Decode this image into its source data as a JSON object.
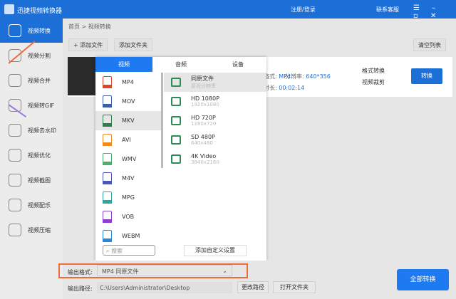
{
  "titlebar": {
    "title": "迅捷视频转换器",
    "login": "注册/登录",
    "support": "联系客服",
    "window_controls": "☰ – ▫ ✕"
  },
  "sidebar": {
    "items": [
      {
        "label": "视频转换"
      },
      {
        "label": "视频分割"
      },
      {
        "label": "视频合并"
      },
      {
        "label": "视频转GIF"
      },
      {
        "label": "视频去水印"
      },
      {
        "label": "视频优化"
      },
      {
        "label": "视频截图"
      },
      {
        "label": "视频配乐"
      },
      {
        "label": "视频压缩"
      }
    ]
  },
  "breadcrumb": "首页 > 视频转换",
  "toolbar": {
    "add_file": "+ 添加文件",
    "add_folder": "添加文件夹",
    "clear": "清空列表"
  },
  "file": {
    "format_label": "格式:",
    "format": "MP4",
    "resolution_label": "分辨率:",
    "resolution": "640*356",
    "duration_label": "时长:",
    "duration": "00:02:14",
    "format_convert": "格式转换",
    "video_cut": "视频裁剪",
    "convert": "转换"
  },
  "popup": {
    "tabs": [
      "视频",
      "音频",
      "设备"
    ],
    "formats": [
      {
        "name": "MP4",
        "color": "#d9472b"
      },
      {
        "name": "MOV",
        "color": "#3b5ea8"
      },
      {
        "name": "MKV",
        "color": "#2e7d4f"
      },
      {
        "name": "AVI",
        "color": "#f08a24"
      },
      {
        "name": "WMV",
        "color": "#4caf6a"
      },
      {
        "name": "M4V",
        "color": "#4a57b5"
      },
      {
        "name": "MPG",
        "color": "#2aa89a"
      },
      {
        "name": "VOB",
        "color": "#8c3fd1"
      },
      {
        "name": "WEBM",
        "color": "#2a86d6"
      }
    ],
    "resolutions": [
      {
        "name": "同原文件",
        "sub": "原视分辨率"
      },
      {
        "name": "HD 1080P",
        "sub": "1920x1080"
      },
      {
        "name": "HD 720P",
        "sub": "1280x720"
      },
      {
        "name": "SD 480P",
        "sub": "640x480"
      },
      {
        "name": "4K Video",
        "sub": "3840x2160"
      }
    ],
    "search_placeholder": "搜索",
    "custom": "添加自定义设置"
  },
  "output": {
    "format_label": "输出格式:",
    "format_value": "MP4  同原文件",
    "path_label": "输出路径:",
    "path": "C:\\Users\\Administrator\\Desktop",
    "change_path": "更改路径",
    "open_folder": "打开文件夹",
    "convert_all": "全部转换"
  }
}
